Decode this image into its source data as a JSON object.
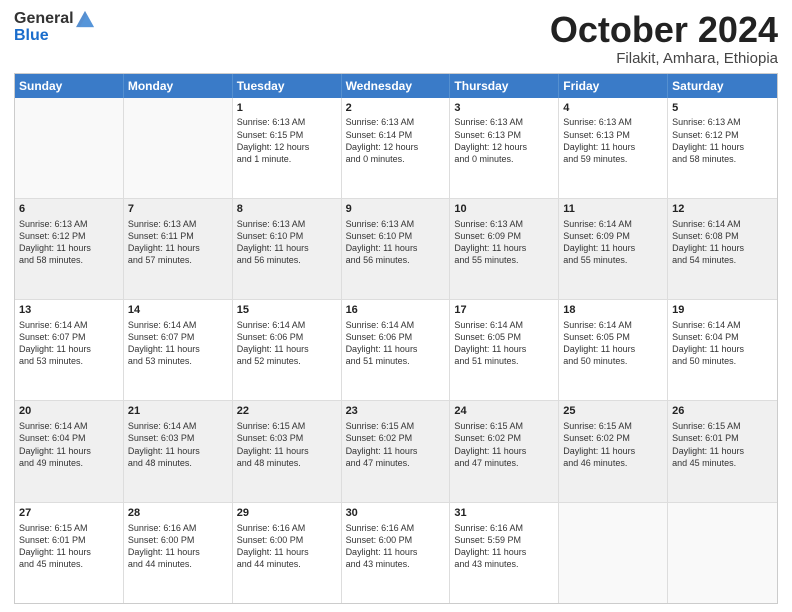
{
  "header": {
    "logo_general": "General",
    "logo_blue": "Blue",
    "month": "October 2024",
    "location": "Filakit, Amhara, Ethiopia"
  },
  "days": [
    "Sunday",
    "Monday",
    "Tuesday",
    "Wednesday",
    "Thursday",
    "Friday",
    "Saturday"
  ],
  "weeks": [
    [
      {
        "day": "",
        "info": ""
      },
      {
        "day": "",
        "info": ""
      },
      {
        "day": "1",
        "info": "Sunrise: 6:13 AM\nSunset: 6:15 PM\nDaylight: 12 hours\nand 1 minute."
      },
      {
        "day": "2",
        "info": "Sunrise: 6:13 AM\nSunset: 6:14 PM\nDaylight: 12 hours\nand 0 minutes."
      },
      {
        "day": "3",
        "info": "Sunrise: 6:13 AM\nSunset: 6:13 PM\nDaylight: 12 hours\nand 0 minutes."
      },
      {
        "day": "4",
        "info": "Sunrise: 6:13 AM\nSunset: 6:13 PM\nDaylight: 11 hours\nand 59 minutes."
      },
      {
        "day": "5",
        "info": "Sunrise: 6:13 AM\nSunset: 6:12 PM\nDaylight: 11 hours\nand 58 minutes."
      }
    ],
    [
      {
        "day": "6",
        "info": "Sunrise: 6:13 AM\nSunset: 6:12 PM\nDaylight: 11 hours\nand 58 minutes."
      },
      {
        "day": "7",
        "info": "Sunrise: 6:13 AM\nSunset: 6:11 PM\nDaylight: 11 hours\nand 57 minutes."
      },
      {
        "day": "8",
        "info": "Sunrise: 6:13 AM\nSunset: 6:10 PM\nDaylight: 11 hours\nand 56 minutes."
      },
      {
        "day": "9",
        "info": "Sunrise: 6:13 AM\nSunset: 6:10 PM\nDaylight: 11 hours\nand 56 minutes."
      },
      {
        "day": "10",
        "info": "Sunrise: 6:13 AM\nSunset: 6:09 PM\nDaylight: 11 hours\nand 55 minutes."
      },
      {
        "day": "11",
        "info": "Sunrise: 6:14 AM\nSunset: 6:09 PM\nDaylight: 11 hours\nand 55 minutes."
      },
      {
        "day": "12",
        "info": "Sunrise: 6:14 AM\nSunset: 6:08 PM\nDaylight: 11 hours\nand 54 minutes."
      }
    ],
    [
      {
        "day": "13",
        "info": "Sunrise: 6:14 AM\nSunset: 6:07 PM\nDaylight: 11 hours\nand 53 minutes."
      },
      {
        "day": "14",
        "info": "Sunrise: 6:14 AM\nSunset: 6:07 PM\nDaylight: 11 hours\nand 53 minutes."
      },
      {
        "day": "15",
        "info": "Sunrise: 6:14 AM\nSunset: 6:06 PM\nDaylight: 11 hours\nand 52 minutes."
      },
      {
        "day": "16",
        "info": "Sunrise: 6:14 AM\nSunset: 6:06 PM\nDaylight: 11 hours\nand 51 minutes."
      },
      {
        "day": "17",
        "info": "Sunrise: 6:14 AM\nSunset: 6:05 PM\nDaylight: 11 hours\nand 51 minutes."
      },
      {
        "day": "18",
        "info": "Sunrise: 6:14 AM\nSunset: 6:05 PM\nDaylight: 11 hours\nand 50 minutes."
      },
      {
        "day": "19",
        "info": "Sunrise: 6:14 AM\nSunset: 6:04 PM\nDaylight: 11 hours\nand 50 minutes."
      }
    ],
    [
      {
        "day": "20",
        "info": "Sunrise: 6:14 AM\nSunset: 6:04 PM\nDaylight: 11 hours\nand 49 minutes."
      },
      {
        "day": "21",
        "info": "Sunrise: 6:14 AM\nSunset: 6:03 PM\nDaylight: 11 hours\nand 48 minutes."
      },
      {
        "day": "22",
        "info": "Sunrise: 6:15 AM\nSunset: 6:03 PM\nDaylight: 11 hours\nand 48 minutes."
      },
      {
        "day": "23",
        "info": "Sunrise: 6:15 AM\nSunset: 6:02 PM\nDaylight: 11 hours\nand 47 minutes."
      },
      {
        "day": "24",
        "info": "Sunrise: 6:15 AM\nSunset: 6:02 PM\nDaylight: 11 hours\nand 47 minutes."
      },
      {
        "day": "25",
        "info": "Sunrise: 6:15 AM\nSunset: 6:02 PM\nDaylight: 11 hours\nand 46 minutes."
      },
      {
        "day": "26",
        "info": "Sunrise: 6:15 AM\nSunset: 6:01 PM\nDaylight: 11 hours\nand 45 minutes."
      }
    ],
    [
      {
        "day": "27",
        "info": "Sunrise: 6:15 AM\nSunset: 6:01 PM\nDaylight: 11 hours\nand 45 minutes."
      },
      {
        "day": "28",
        "info": "Sunrise: 6:16 AM\nSunset: 6:00 PM\nDaylight: 11 hours\nand 44 minutes."
      },
      {
        "day": "29",
        "info": "Sunrise: 6:16 AM\nSunset: 6:00 PM\nDaylight: 11 hours\nand 44 minutes."
      },
      {
        "day": "30",
        "info": "Sunrise: 6:16 AM\nSunset: 6:00 PM\nDaylight: 11 hours\nand 43 minutes."
      },
      {
        "day": "31",
        "info": "Sunrise: 6:16 AM\nSunset: 5:59 PM\nDaylight: 11 hours\nand 43 minutes."
      },
      {
        "day": "",
        "info": ""
      },
      {
        "day": "",
        "info": ""
      }
    ]
  ]
}
